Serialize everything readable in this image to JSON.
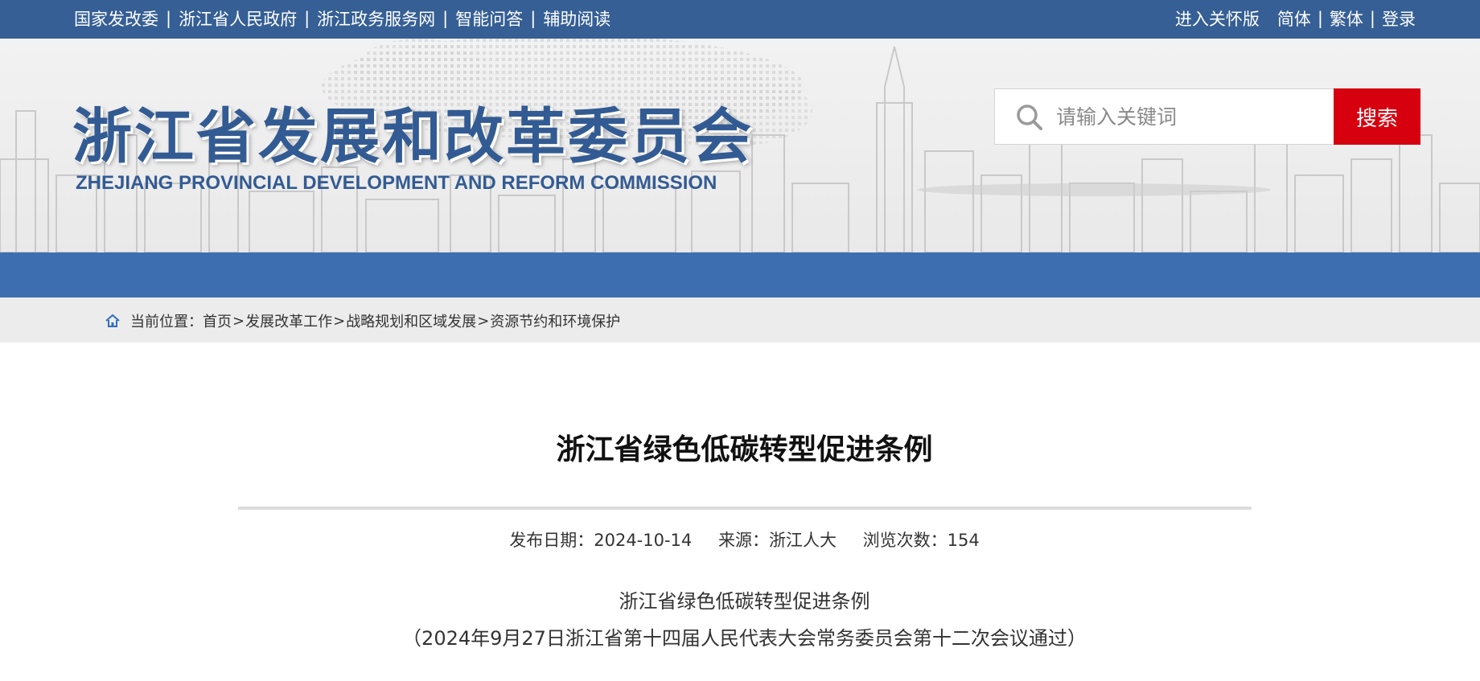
{
  "topbar": {
    "links": [
      "国家发改委",
      "浙江省人民政府",
      "浙江政务服务网",
      "智能问答",
      "辅助阅读"
    ],
    "separator": "|",
    "care_mode": "进入关怀版",
    "simplified": "简体",
    "traditional": "繁体",
    "login": "登录"
  },
  "header": {
    "logo_cn": "浙江省发展和改革委员会",
    "logo_en": "ZHEJIANG PROVINCIAL DEVELOPMENT AND REFORM COMMISSION"
  },
  "search": {
    "placeholder": "请输入关键词",
    "value": "",
    "button": "搜索"
  },
  "breadcrumb": {
    "prefix": "当前位置：",
    "items": [
      "首页",
      "发展改革工作",
      "战略规划和区域发展",
      "资源节约和环境保护"
    ],
    "separator": ">"
  },
  "article": {
    "title": "浙江省绿色低碳转型促进条例",
    "date_label": "发布日期：",
    "date": "2024-10-14",
    "source_label": "来源：",
    "source": "浙江人大",
    "views_label": "浏览次数：",
    "views": "154",
    "subtitle": "浙江省绿色低碳转型促进条例",
    "adoption_note": "（2024年9月27日浙江省第十四届人民代表大会常务委员会第十二次会议通过）"
  },
  "colors": {
    "topbar": "#355f95",
    "nav": "#3c6eb0",
    "logo": "#335b93",
    "search_button": "#d6000f",
    "crumb_bg": "#ececec"
  },
  "icons": {
    "search": "search-icon",
    "home": "home-icon"
  }
}
